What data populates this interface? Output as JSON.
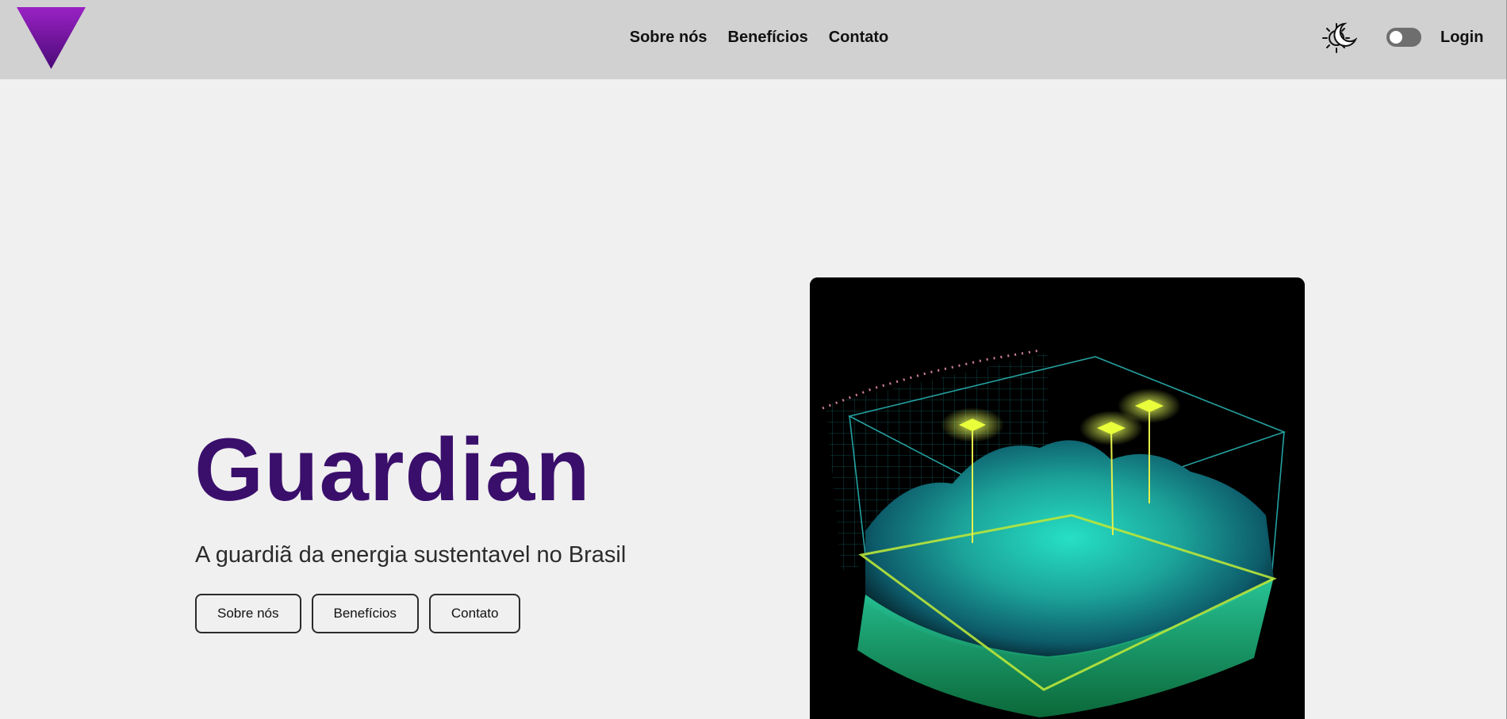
{
  "header": {
    "nav": [
      "Sobre nós",
      "Benefícios",
      "Contato"
    ],
    "login_label": "Login"
  },
  "hero": {
    "title": "Guardian",
    "subtitle": "A guardiã da energia sustentavel no Brasil",
    "buttons": [
      "Sobre nós",
      "Benefícios",
      "Contato"
    ]
  },
  "icons": {
    "logo": "purple-triangle-logo",
    "theme": "sun-moon-icon"
  },
  "colors": {
    "header_bg": "#d1d1d1",
    "page_bg": "#f0f0f0",
    "title": "#3a0f6b",
    "logo_top": "#8a1fb8",
    "logo_bottom": "#4a0a78"
  },
  "theme_toggle": {
    "on": false
  }
}
